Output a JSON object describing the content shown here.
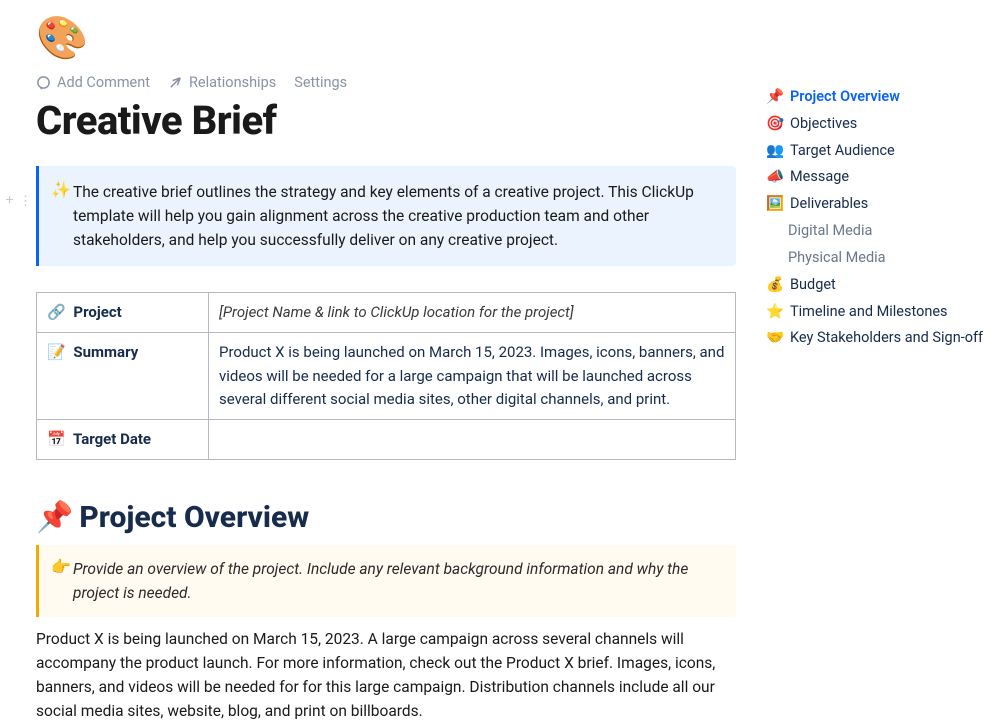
{
  "page_icon": "🎨",
  "toolbar": {
    "add_comment": "Add Comment",
    "relationships": "Relationships",
    "settings": "Settings"
  },
  "title": "Creative Brief",
  "intro_callout": {
    "emoji": "✨",
    "text": "The creative brief outlines the strategy and key elements of a creative project. This ClickUp template will help you gain alignment across the creative production team and other stakeholders, and help you successfully deliver on any creative project."
  },
  "info_table": {
    "project": {
      "emoji": "🔗",
      "label": "Project",
      "value": "[Project Name & link to ClickUp location for the project]"
    },
    "summary": {
      "emoji": "📝",
      "label": "Summary",
      "value": "Product X is being launched on March 15, 2023. Images, icons, banners, and videos will be needed for a large campaign that will be launched across several different social media sites, other digital channels, and print."
    },
    "target_date": {
      "emoji": "📅",
      "label": "Target Date",
      "value": ""
    }
  },
  "section_overview": {
    "emoji": "📌",
    "heading": "Project Overview",
    "hint_emoji": "👉",
    "hint": "Provide an overview of the project. Include any relevant background information and why the project is needed.",
    "body": "Product X is being launched on March 15, 2023. A large campaign across several channels will accompany the product launch. For more information, check out the Product X brief. Images, icons, banners, and videos will be needed for for this large campaign. Distribution channels include all our social media sites, website, blog, and print on billboards."
  },
  "outline": [
    {
      "emoji": "📌",
      "label": "Project Overview",
      "active": true
    },
    {
      "emoji": "🎯",
      "label": "Objectives"
    },
    {
      "emoji": "👥",
      "label": "Target Audience"
    },
    {
      "emoji": "📣",
      "label": "Message"
    },
    {
      "emoji": "🖼️",
      "label": "Deliverables"
    },
    {
      "label": "Digital Media",
      "sub": true
    },
    {
      "label": "Physical Media",
      "sub": true
    },
    {
      "emoji": "💰",
      "label": "Budget"
    },
    {
      "emoji": "⭐",
      "label": "Timeline and Milestones"
    },
    {
      "emoji": "🤝",
      "label": "Key Stakeholders and Sign-off"
    }
  ]
}
